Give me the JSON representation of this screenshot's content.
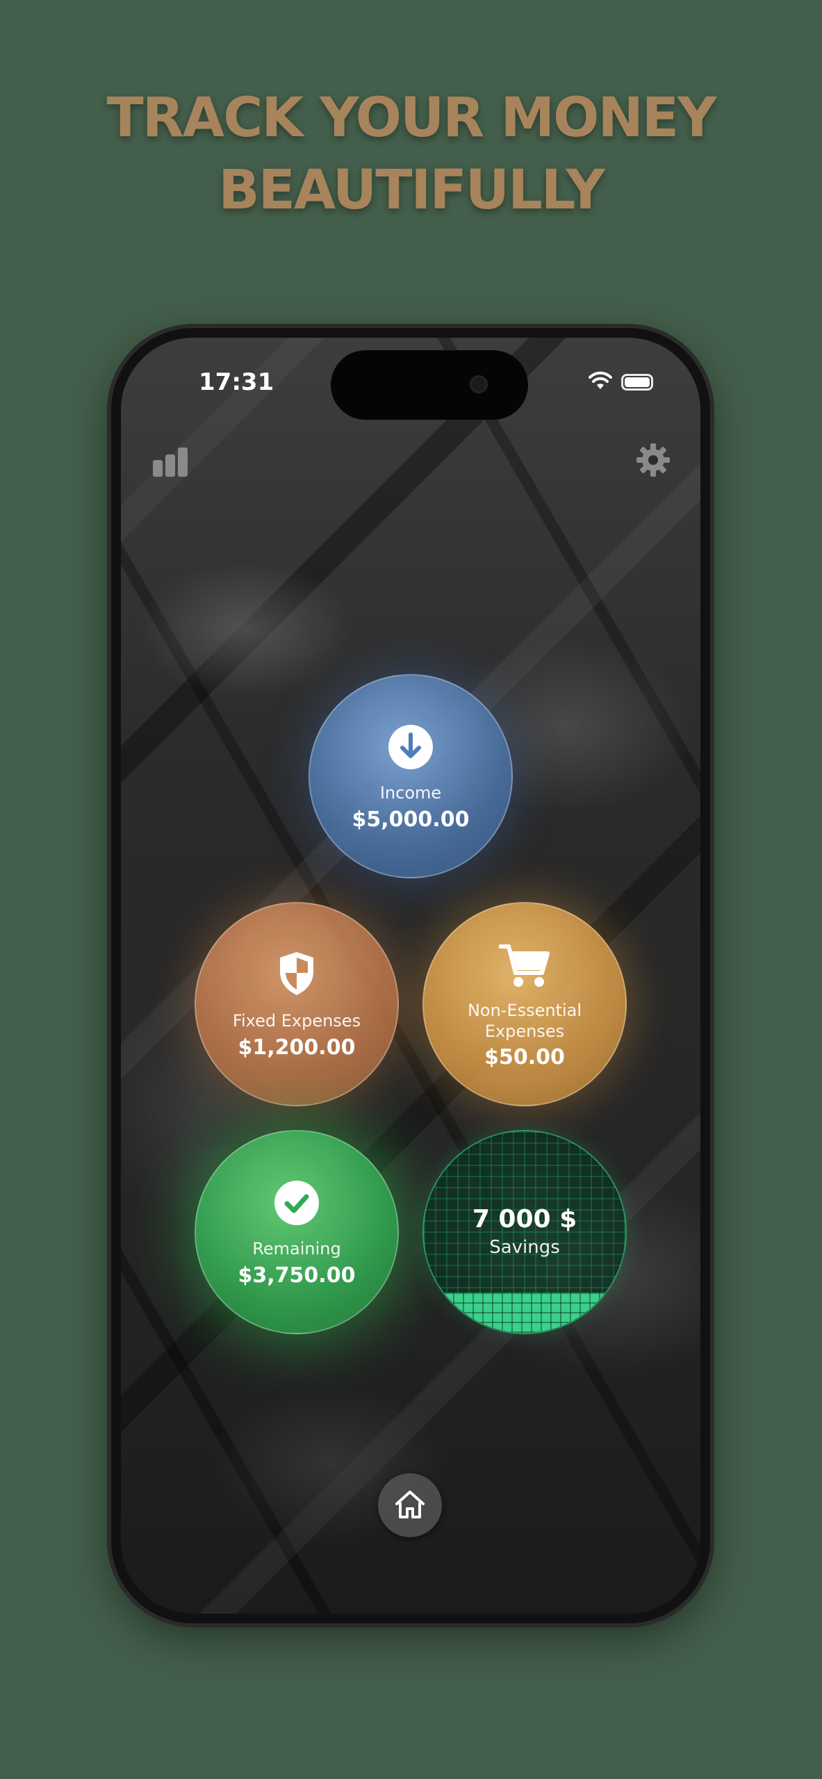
{
  "headline": {
    "line1": "TRACK YOUR MONEY",
    "line2": "BEAUTIFULLY"
  },
  "status_bar": {
    "time": "17:31",
    "icons": [
      "wifi-icon",
      "battery-icon"
    ]
  },
  "toolbar": {
    "left_icon": "bar-chart-icon",
    "right_icon": "gear-icon"
  },
  "bubbles": {
    "income": {
      "label": "Income",
      "value": "$5,000.00",
      "icon": "arrow-down-circle-icon",
      "color": "#5f8cc6"
    },
    "fixed": {
      "label": "Fixed Expenses",
      "value": "$1,200.00",
      "icon": "shield-icon",
      "color": "#c98a5a"
    },
    "nonessential": {
      "label_line1": "Non-Essential",
      "label_line2": "Expenses",
      "value": "$50.00",
      "icon": "cart-icon",
      "color": "#e0a858"
    },
    "remaining": {
      "label": "Remaining",
      "value": "$3,750.00",
      "icon": "checkmark-circle-icon",
      "color": "#3cb85f"
    },
    "savings": {
      "value": "7 000 $",
      "label": "Savings",
      "progress": 0.2,
      "color": "#3ad18a"
    }
  },
  "bottom_nav": {
    "home_icon": "home-icon"
  },
  "colors": {
    "page_background": "#435e4a",
    "headline": "#a7845c"
  }
}
